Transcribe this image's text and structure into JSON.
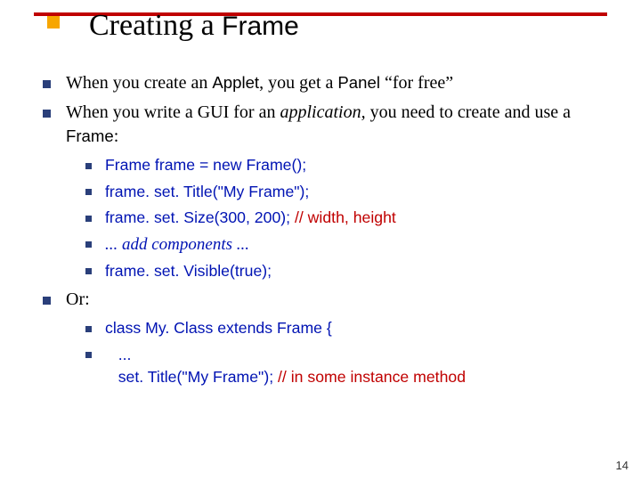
{
  "title": {
    "pre": "Creating a ",
    "sans": "Frame"
  },
  "b1": {
    "a": "When you create an ",
    "b": "Applet",
    "c": ", you get a ",
    "d": "Panel",
    "e": " “for free”"
  },
  "b2": {
    "a": "When you write a GUI for an ",
    "b": "application,",
    "c": " you need to create and use a ",
    "d": "Frame",
    "e": ":"
  },
  "c1": "Frame frame = new Frame();",
  "c2": "frame. set. Title(\"My Frame\");",
  "c3a": "frame. set. Size(300, 200); ",
  "c3b": "// width, height",
  "c4": "... add components ...",
  "c5": "frame. set. Visible(true);",
  "or": "Or:",
  "d1": "class My. Class extends Frame {",
  "d2a": "   ...",
  "d2b": "   set. Title(\"My Frame\"); ",
  "d2c": "// in some instance method",
  "pagenum": "14"
}
